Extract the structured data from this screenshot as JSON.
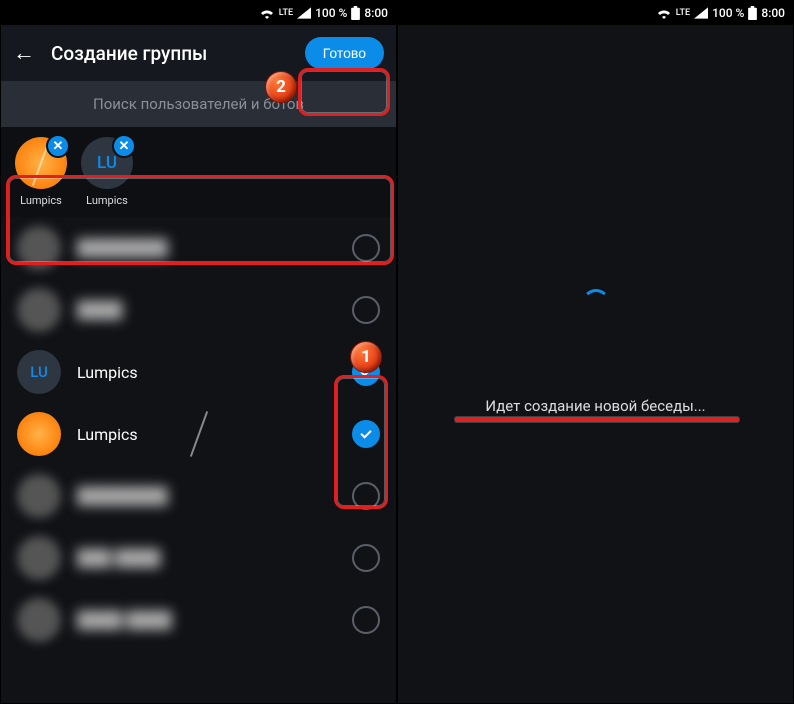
{
  "statusbar": {
    "lte": "LTE",
    "battery": "100 %",
    "time": "8:00"
  },
  "header": {
    "title": "Создание группы",
    "done": "Готово"
  },
  "search": {
    "placeholder": "Поиск пользователей и ботов"
  },
  "chips": [
    {
      "label": "Lumpics",
      "avatar": "orange",
      "initials": ""
    },
    {
      "label": "Lumpics",
      "avatar": "lu",
      "initials": "LU"
    }
  ],
  "contacts": [
    {
      "name": "████████",
      "blur": true,
      "checked": false,
      "avatar": "blur"
    },
    {
      "name": "████",
      "blur": true,
      "checked": false,
      "avatar": "blur"
    },
    {
      "name": "Lumpics",
      "blur": false,
      "checked": true,
      "avatar": "lu",
      "initials": "LU"
    },
    {
      "name": "Lumpics",
      "blur": false,
      "checked": true,
      "avatar": "orange"
    },
    {
      "name": "████████",
      "blur": true,
      "checked": false,
      "avatar": "blur"
    },
    {
      "name": "███ ████",
      "blur": true,
      "checked": false,
      "avatar": "blur"
    },
    {
      "name": "████ ████",
      "blur": true,
      "checked": false,
      "avatar": "blur"
    }
  ],
  "loading": {
    "text": "Идет создание новой беседы..."
  },
  "markers": {
    "one": "1",
    "two": "2"
  }
}
